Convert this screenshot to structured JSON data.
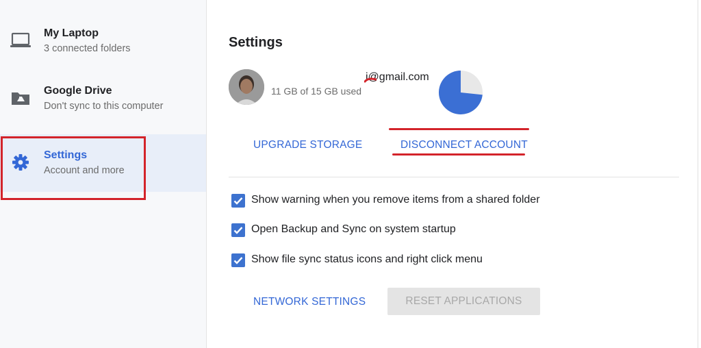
{
  "sidebar": {
    "items": [
      {
        "title": "My Laptop",
        "subtitle": "3 connected folders",
        "icon": "laptop-icon"
      },
      {
        "title": "Google Drive",
        "subtitle": "Don't sync to this computer",
        "icon": "drive-folder-icon"
      },
      {
        "title": "Settings",
        "subtitle": "Account and more",
        "icon": "gear-icon",
        "active": true
      }
    ]
  },
  "settings": {
    "title": "Settings",
    "account": {
      "email": "i@gmail.com",
      "usage": "11 GB of 15 GB used",
      "used_fraction": 0.7333
    },
    "upgrade_label": "UPGRADE STORAGE",
    "disconnect_label": "DISCONNECT ACCOUNT",
    "options": [
      {
        "label": "Show warning when you remove items from a shared folder",
        "checked": true
      },
      {
        "label": "Open Backup and Sync on system startup",
        "checked": true
      },
      {
        "label": "Show file sync status icons and right click menu",
        "checked": true
      }
    ],
    "network_label": "NETWORK SETTINGS",
    "reset_label": "RESET APPLICATIONS"
  },
  "colors": {
    "accent": "#3367d6",
    "checkbox": "#3d72cf",
    "annotation": "#d3232a",
    "pie_used": "#3b6fd4",
    "pie_free": "#e8e8e8"
  }
}
